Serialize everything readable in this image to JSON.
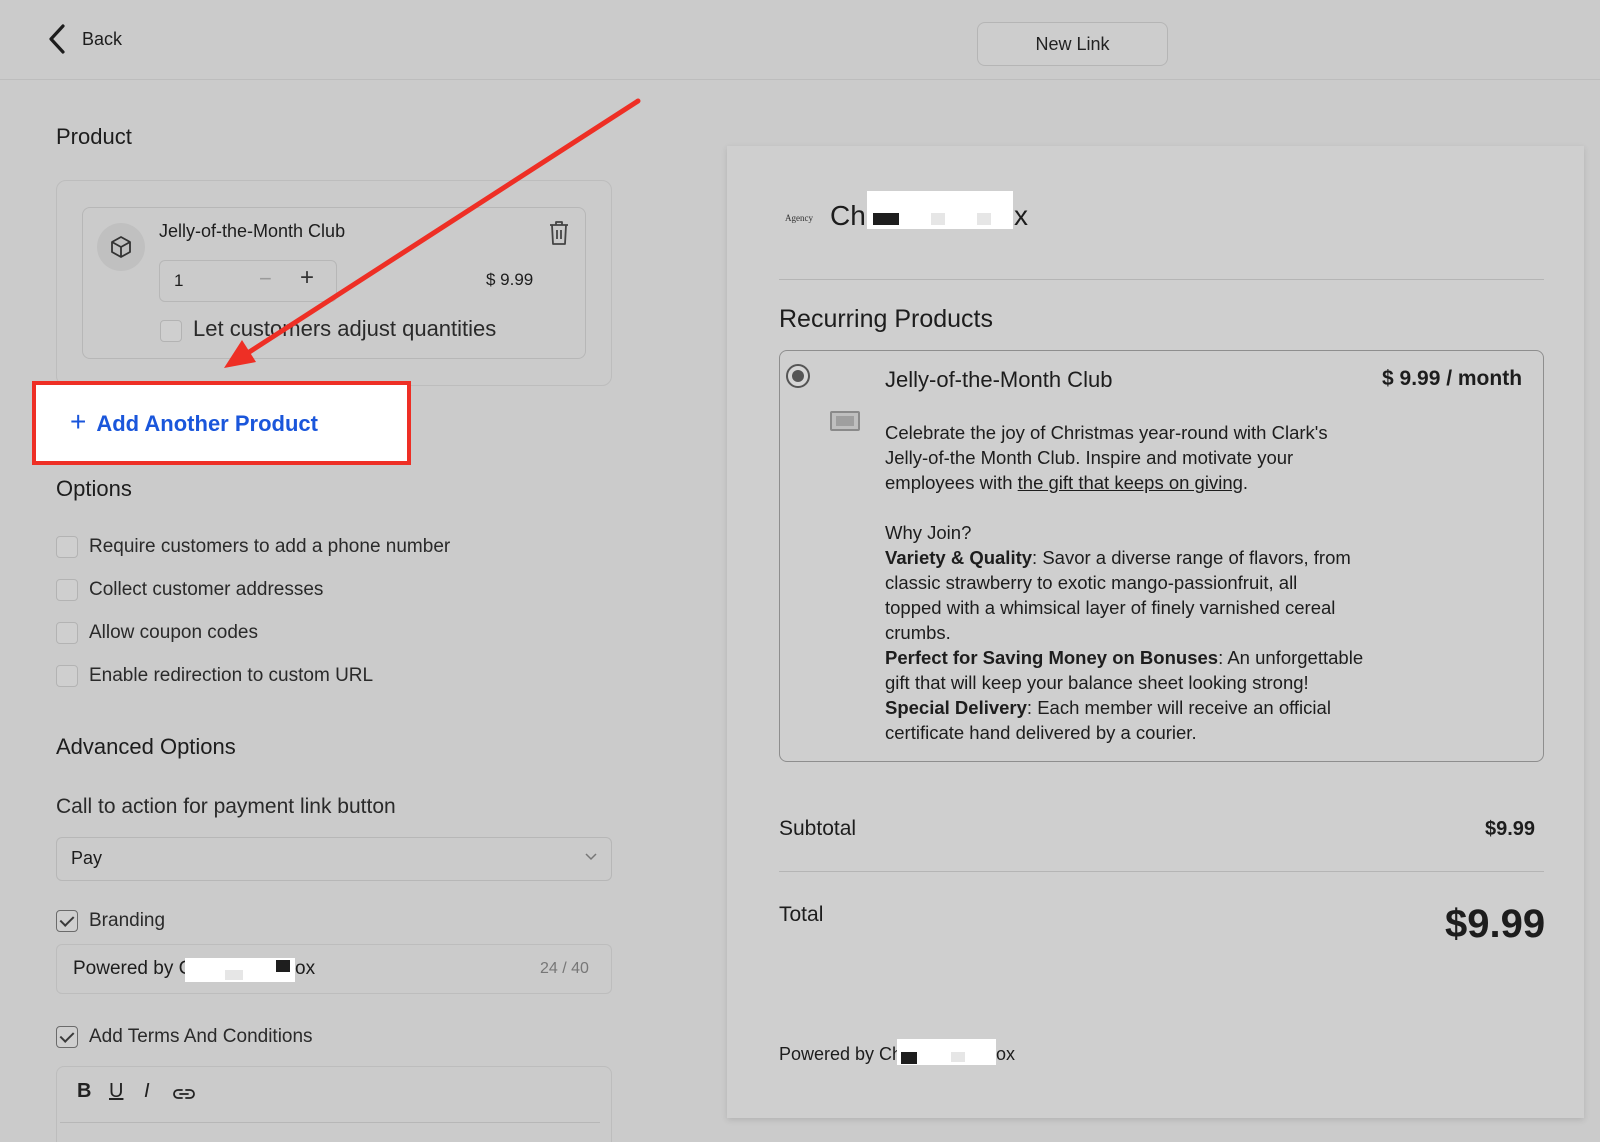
{
  "header": {
    "back_label": "Back",
    "new_link_label": "New Link"
  },
  "product_section": {
    "title": "Product",
    "product": {
      "name": "Jelly-of-the-Month Club",
      "quantity": "1",
      "price": "$ 9.99",
      "adjust_label": "Let customers adjust quantities",
      "adjust_checked": false
    },
    "add_another_label": "Add Another Product"
  },
  "options": {
    "title": "Options",
    "items": [
      {
        "label": "Require customers to add a phone number",
        "checked": false
      },
      {
        "label": "Collect customer addresses",
        "checked": false
      },
      {
        "label": "Allow coupon codes",
        "checked": false
      },
      {
        "label": "Enable redirection to custom URL",
        "checked": false
      }
    ]
  },
  "advanced": {
    "title": "Advanced Options",
    "cta_label": "Call to action for payment link button",
    "cta_value": "Pay",
    "branding_label": "Branding",
    "branding_checked": true,
    "branding_text_prefix": "Powered by C",
    "branding_text_suffix": "ox",
    "branding_count": "24 / 40",
    "terms_label": "Add Terms And Conditions",
    "terms_checked": true,
    "editor_tools": [
      "B",
      "U",
      "I",
      "link-icon"
    ]
  },
  "preview": {
    "logo_text": "Agency",
    "merchant_prefix": "Ch",
    "merchant_suffix": "x",
    "recurring_title": "Recurring Products",
    "item_name": "Jelly-of-the-Month Club",
    "item_price": "$ 9.99 / month",
    "desc_line1": "Celebrate the joy of Christmas year-round with Clark's",
    "desc_line2": "Jelly-of-the Month Club. Inspire and motivate your",
    "desc_line3_pre": "employees with ",
    "desc_line3_link": "the gift that keeps on giving",
    "desc_line3_post": ".",
    "why_join": "Why Join?",
    "vq_bold": "Variety & Quality",
    "vq_line1": ": Savor a diverse range of flavors, from",
    "vq_line2": "classic strawberry to exotic mango-passionfruit, all",
    "vq_line3": "topped with a whimsical layer of finely varnished cereal",
    "vq_line4": "crumbs.",
    "pf_bold": "Perfect for Saving Money on Bonuses",
    "pf_line1": ": An unforgettable",
    "pf_line2": "gift that will keep your balance sheet looking strong!",
    "sd_bold": "Special Delivery",
    "sd_line1": ": Each member will receive an official",
    "sd_line2": "certificate hand delivered by a courier.",
    "subtotal_label": "Subtotal",
    "subtotal_value": "$9.99",
    "total_label": "Total",
    "total_value": "$9.99",
    "powered_prefix": "Powered by Ch",
    "powered_suffix": "ox"
  },
  "colors": {
    "background": "#cbcbcb",
    "accent_link": "#1a56db",
    "highlight_box": "#ee2f25",
    "annotation_arrow": "#ee2f25"
  }
}
